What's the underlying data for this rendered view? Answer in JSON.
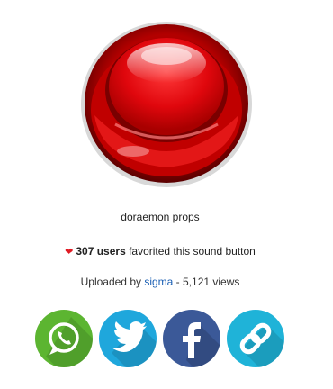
{
  "sound": {
    "title": "doraemon props"
  },
  "favorites": {
    "count_label": "307 users",
    "suffix": " favorited this sound button"
  },
  "upload": {
    "prefix": "Uploaded by ",
    "user": "sigma",
    "suffix": " - 5,121 views"
  },
  "share": {
    "buttons": [
      {
        "icon": "whatsapp-icon",
        "color": "#5cb531"
      },
      {
        "icon": "twitter-icon",
        "color": "#1fa7dc"
      },
      {
        "icon": "facebook-icon",
        "color": "#3b5998"
      },
      {
        "icon": "link-icon",
        "color": "#1fb3d8"
      }
    ]
  },
  "colors": {
    "button_red": "#e0070d",
    "heart": "#e01b24",
    "link": "#1a5fb4"
  }
}
